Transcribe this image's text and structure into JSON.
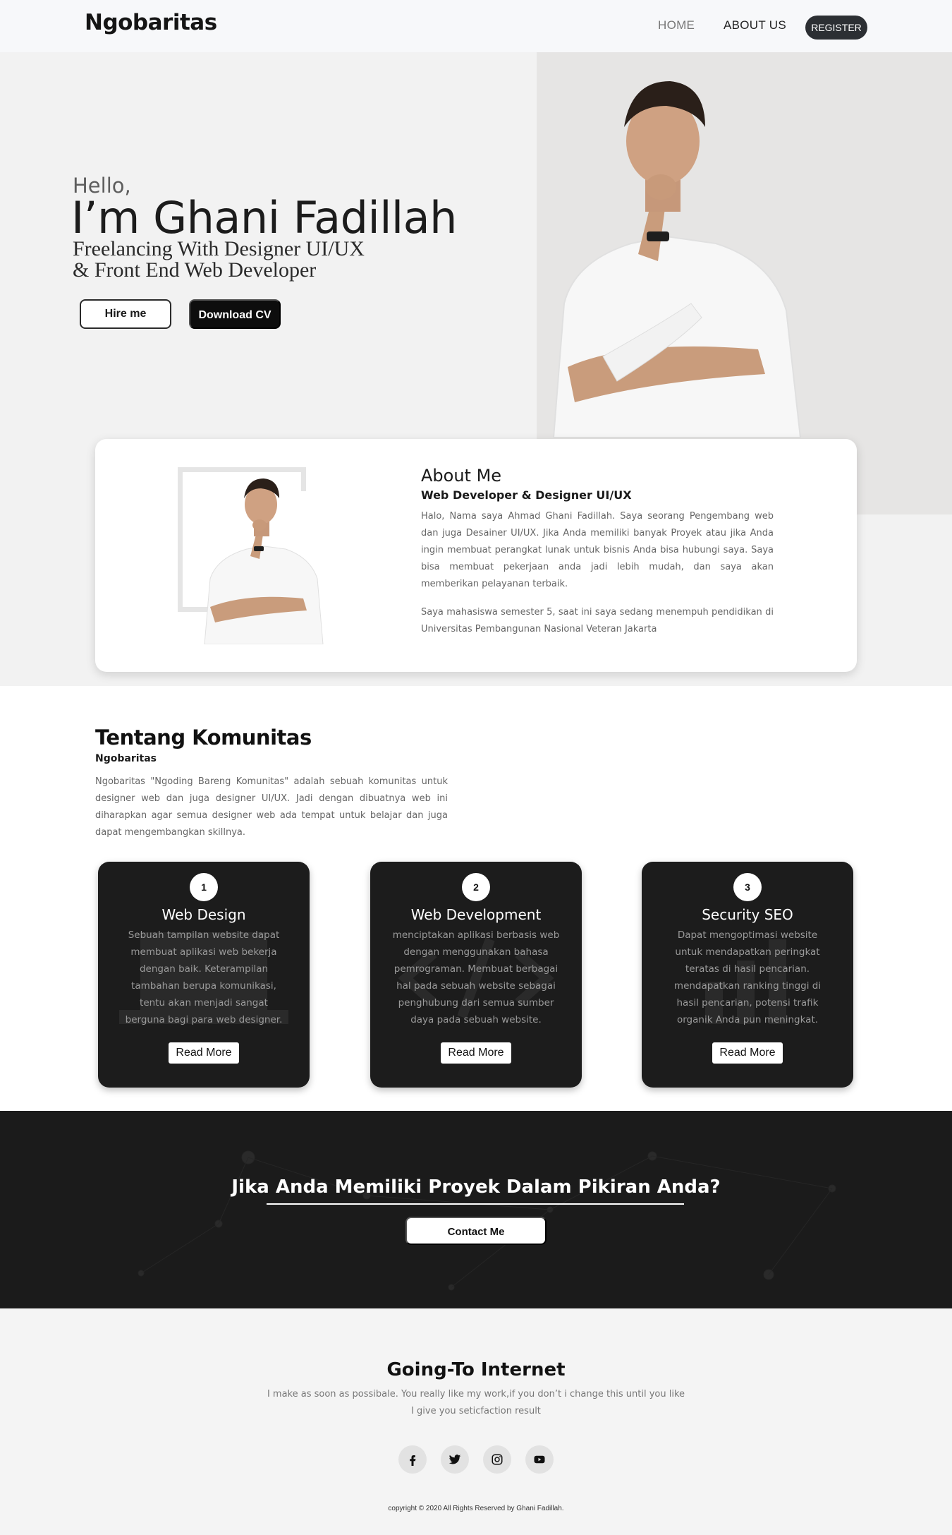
{
  "nav": {
    "brand": "Ngobaritas",
    "home": "HOME",
    "about": "ABOUT US",
    "register": "REGISTER"
  },
  "hero": {
    "hello": "Hello,",
    "name": "I’m Ghani Fadillah",
    "tagline_1": "Freelancing With Designer UI/UX",
    "tagline_2": "& Front End Web Developer",
    "hire_button": "Hire me",
    "cv_button": "Download CV"
  },
  "about": {
    "title": "About Me",
    "subtitle": "Web Developer & Designer UI/UX",
    "paragraph_1": "Halo, Nama saya Ahmad Ghani Fadillah. Saya seorang Pengembang web dan juga Desainer UI/UX. Jika Anda memiliki banyak Proyek atau jika Anda ingin membuat perangkat lunak untuk bisnis Anda bisa hubungi saya. Saya bisa membuat pekerjaan anda jadi lebih mudah, dan saya akan memberikan pelayanan terbaik.",
    "paragraph_2": "Saya mahasiswa semester 5, saat ini saya sedang menempuh pendidikan di Universitas Pembangunan Nasional Veteran Jakarta"
  },
  "komunitas": {
    "title": "Tentang Komunitas",
    "subtitle": "Ngobaritas",
    "description": "Ngobaritas \"Ngoding Bareng Komunitas\" adalah sebuah komunitas untuk designer web dan juga designer UI/UX. Jadi dengan dibuatnya web ini diharapkan agar semua designer web ada tempat untuk belajar dan juga dapat mengembangkan skillnya."
  },
  "services": [
    {
      "number": "1",
      "title": "Web Design",
      "text": "Sebuah tampilan website dapat membuat aplikasi web bekerja dengan baik. Keterampilan tambahan berupa komunikasi, tentu akan menjadi sangat berguna bagi para web designer.",
      "button": "Read More"
    },
    {
      "number": "2",
      "title": "Web Development",
      "text": "menciptakan aplikasi berbasis web dengan menggunakan bahasa pemrograman. Membuat berbagai hal pada sebuah website sebagai penghubung dari semua sumber daya pada sebuah website.",
      "button": "Read More"
    },
    {
      "number": "3",
      "title": "Security SEO",
      "text": "Dapat mengoptimasi website untuk mendapatkan peringkat teratas di hasil pencarian. mendapatkan ranking tinggi di hasil pencarian, potensi trafik organik Anda pun meningkat.",
      "button": "Read More"
    }
  ],
  "cta": {
    "title": "Jika Anda Memiliki Proyek Dalam Pikiran Anda?",
    "button": "Contact Me"
  },
  "footer": {
    "title": "Going-To Internet",
    "description": "I make as soon as possibale. You really like my work,if you don’t i change this until you like I give you seticfaction result",
    "social": [
      "facebook-icon",
      "twitter-icon",
      "instagram-icon",
      "youtube-icon"
    ],
    "copyright": "copyright © 2020 All Rights Reserved by Ghani Fadillah."
  },
  "colors": {
    "accent_dark": "#1c1c1c",
    "nav_bg": "#f7f8fa",
    "register_bg": "#2c2f33"
  }
}
